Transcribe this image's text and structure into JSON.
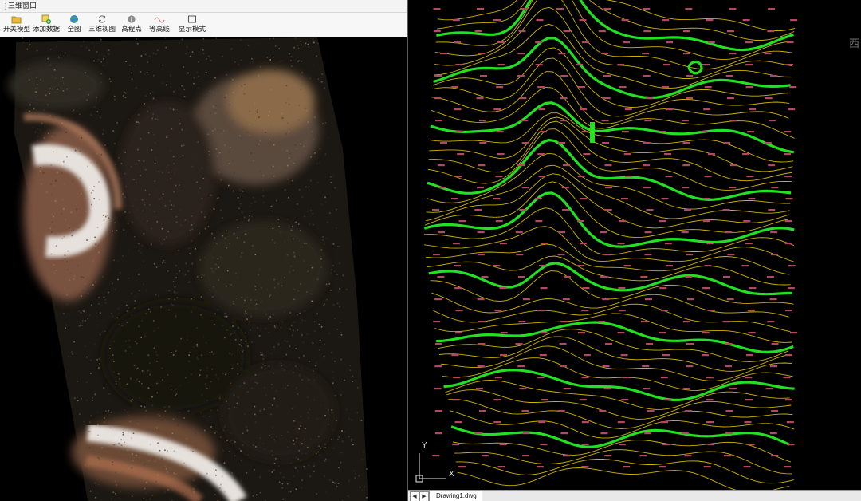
{
  "window": {
    "title": "三维窗口"
  },
  "toolbar": {
    "buttons": [
      {
        "label": "开关模型",
        "icon": "folder-open-icon"
      },
      {
        "label": "添加数据",
        "icon": "add-data-icon"
      },
      {
        "label": "全图",
        "icon": "globe-icon"
      },
      {
        "label": "三维视图",
        "icon": "rotate-view-icon"
      },
      {
        "label": "高程点",
        "icon": "elevation-point-icon"
      },
      {
        "label": "等高线",
        "icon": "contour-icon"
      },
      {
        "label": "显示模式",
        "icon": "display-mode-icon"
      }
    ]
  },
  "cad": {
    "tab_label": "Drawing1.dwg",
    "axis_x": "X",
    "axis_y": "Y",
    "nav_prev": "◀",
    "nav_next": "▶",
    "side_glyph": "西",
    "colors": {
      "index_contour": "#22e022",
      "intermediate_contour": "#cfb400",
      "elevation_label": "#b04a62",
      "background": "#000000"
    }
  },
  "scene": {
    "colors": {
      "terrain_dark": "#1b1712",
      "terrain_light": "#8a6a4a",
      "road": "#e6e1dc"
    }
  }
}
